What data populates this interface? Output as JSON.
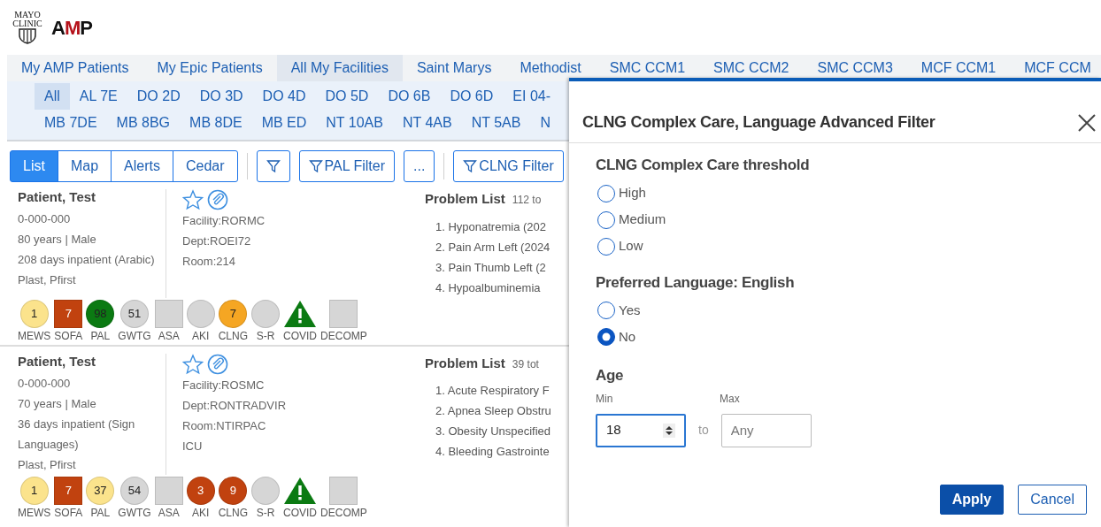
{
  "logo": {
    "org": "MAYO CLINIC",
    "app": "AMP"
  },
  "tabs": [
    {
      "label": "My AMP Patients",
      "selected": false
    },
    {
      "label": "My Epic Patients",
      "selected": false
    },
    {
      "label": "All My Facilities",
      "selected": true
    },
    {
      "label": "Saint Marys",
      "selected": false
    },
    {
      "label": "Methodist",
      "selected": false
    },
    {
      "label": "SMC CCM1",
      "selected": false
    },
    {
      "label": "SMC CCM2",
      "selected": false
    },
    {
      "label": "SMC CCM3",
      "selected": false
    },
    {
      "label": "MCF CCM1",
      "selected": false
    },
    {
      "label": "MCF CCM",
      "selected": false
    }
  ],
  "units": [
    [
      {
        "label": "All",
        "selected": true
      },
      {
        "label": "AL 7E",
        "selected": false
      },
      {
        "label": "DO 2D",
        "selected": false
      },
      {
        "label": "DO 3D",
        "selected": false
      },
      {
        "label": "DO 4D",
        "selected": false
      },
      {
        "label": "DO 5D",
        "selected": false
      },
      {
        "label": "DO 6B",
        "selected": false
      },
      {
        "label": "DO 6D",
        "selected": false
      },
      {
        "label": "EI 04-",
        "selected": false
      }
    ],
    [
      {
        "label": "MB 7DE",
        "selected": false
      },
      {
        "label": "MB 8BG",
        "selected": false
      },
      {
        "label": "MB 8DE",
        "selected": false
      },
      {
        "label": "MB ED",
        "selected": false
      },
      {
        "label": "NT 10AB",
        "selected": false
      },
      {
        "label": "NT 4AB",
        "selected": false
      },
      {
        "label": "NT 5AB",
        "selected": false
      },
      {
        "label": "N",
        "selected": false
      }
    ]
  ],
  "view_switch": [
    {
      "label": "List",
      "selected": true
    },
    {
      "label": "Map",
      "selected": false
    },
    {
      "label": "Alerts",
      "selected": false
    },
    {
      "label": "Cedar",
      "selected": false
    }
  ],
  "toolbar": [
    {
      "kind": "divider"
    },
    {
      "kind": "filter-icon"
    },
    {
      "kind": "filter",
      "label": "PAL Filter"
    },
    {
      "kind": "more",
      "label": "..."
    },
    {
      "kind": "divider"
    },
    {
      "kind": "filter",
      "label": "CLNG Filter"
    }
  ],
  "patients": [
    {
      "name": "Patient, Test",
      "mrn": "0-000-000",
      "demographics": "80 years | Male",
      "stay": "208 days inpatient (Arabic)",
      "providers": "Plast, Pfirst",
      "details": [
        "Facility:RORMC",
        "Dept:ROEI72",
        "Room:214"
      ],
      "problem_list": {
        "title": "Problem List",
        "count": "112 to",
        "items": [
          "1. Hyponatremia (202",
          "2. Pain Arm Left (2024",
          "3. Pain Thumb Left (2",
          "4. Hypoalbuminemia"
        ]
      },
      "scores": [
        {
          "kind": "circle",
          "value": "1",
          "label": "MEWS",
          "color": "#fbe38c"
        },
        {
          "kind": "square",
          "value": "7",
          "label": "SOFA",
          "color": "#c1420f"
        },
        {
          "kind": "circle",
          "value": "98",
          "label": "PAL",
          "color": "#0b7a12"
        },
        {
          "kind": "circle",
          "value": "51",
          "label": "GWTG",
          "color": "#d6d6d6"
        },
        {
          "kind": "square",
          "label": "ASA",
          "color": "#d6d6d6"
        },
        {
          "kind": "circle",
          "label": "AKI",
          "color": "#d6d6d6"
        },
        {
          "kind": "circle",
          "value": "7",
          "label": "CLNG",
          "color": "#f5a623"
        },
        {
          "kind": "circle",
          "label": "S-R",
          "color": "#d6d6d6"
        },
        {
          "kind": "triangle",
          "label": "COVID",
          "color": "#0b7a12"
        },
        {
          "kind": "square",
          "label": "DECOMP",
          "color": "#d6d6d6"
        }
      ]
    },
    {
      "name": "Patient, Test",
      "mrn": "0-000-000",
      "demographics": "70 years | Male",
      "stay": "36 days inpatient (Sign Languages)",
      "providers": "Plast, Pfirst",
      "details": [
        "Facility:ROSMC",
        "Dept:RONTRADVIR",
        "Room:NTIRPAC",
        "ICU"
      ],
      "problem_list": {
        "title": "Problem List",
        "count": "39 tot",
        "items": [
          "1. Acute Respiratory F",
          "2. Apnea Sleep Obstru",
          "3. Obesity Unspecified",
          "4. Bleeding Gastrointe"
        ]
      },
      "scores": [
        {
          "kind": "circle",
          "value": "1",
          "label": "MEWS",
          "color": "#fbe38c"
        },
        {
          "kind": "square",
          "value": "7",
          "label": "SOFA",
          "color": "#c1420f"
        },
        {
          "kind": "circle",
          "value": "37",
          "label": "PAL",
          "color": "#fbe38c"
        },
        {
          "kind": "circle",
          "value": "54",
          "label": "GWTG",
          "color": "#d6d6d6"
        },
        {
          "kind": "square",
          "label": "ASA",
          "color": "#d6d6d6"
        },
        {
          "kind": "circle",
          "value": "3",
          "label": "AKI",
          "color": "#c1420f"
        },
        {
          "kind": "circle",
          "value": "9",
          "label": "CLNG",
          "color": "#c1420f"
        },
        {
          "kind": "circle",
          "label": "S-R",
          "color": "#d6d6d6"
        },
        {
          "kind": "triangle",
          "label": "COVID",
          "color": "#0b7a12"
        },
        {
          "kind": "square",
          "label": "DECOMP",
          "color": "#d6d6d6"
        }
      ]
    }
  ],
  "dialog": {
    "title": "CLNG Complex Care, Language Advanced Filter",
    "groups": [
      {
        "title": "CLNG Complex Care threshold",
        "options": [
          {
            "label": "High",
            "selected": false
          },
          {
            "label": "Medium",
            "selected": false
          },
          {
            "label": "Low",
            "selected": false
          }
        ]
      },
      {
        "title": "Preferred Language: English",
        "options": [
          {
            "label": "Yes",
            "selected": false
          },
          {
            "label": "No",
            "selected": true
          }
        ]
      }
    ],
    "age": {
      "title": "Age",
      "min_label": "Min",
      "min_value": "18",
      "separator": "to",
      "max_label": "Max",
      "max_placeholder": "Any"
    },
    "buttons": [
      {
        "label": "Apply",
        "kind": "primary"
      },
      {
        "label": "Cancel",
        "kind": "secondary"
      }
    ]
  }
}
